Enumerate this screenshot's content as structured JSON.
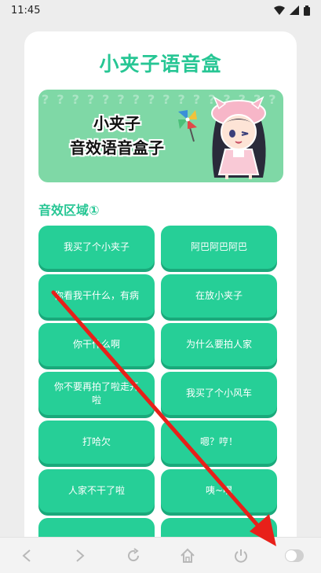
{
  "status_bar": {
    "time": "11:45"
  },
  "app": {
    "title": "小夹子语音盒",
    "banner": {
      "line1": "小夹子",
      "line2": "音效语音盒子"
    },
    "section_title": "音效区域①",
    "buttons": [
      "我买了个小夹子",
      "阿巴阿巴阿巴",
      "你看我干什么，有病",
      "在放小夹子",
      "你干什么啊",
      "为什么要拍人家",
      "你不要再拍了啦走开啦",
      "我买了个小风车",
      "打哈欠",
      "嗯？哼！",
      "人家不干了啦",
      "咦~嘿"
    ]
  },
  "colors": {
    "accent": "#27c694",
    "button": "#26cf97",
    "arrow": "#e8201a"
  },
  "nav_bar": {
    "icons": [
      "back-icon",
      "forward-icon",
      "refresh-icon",
      "home-icon",
      "power-icon",
      "toggle-switch"
    ]
  }
}
